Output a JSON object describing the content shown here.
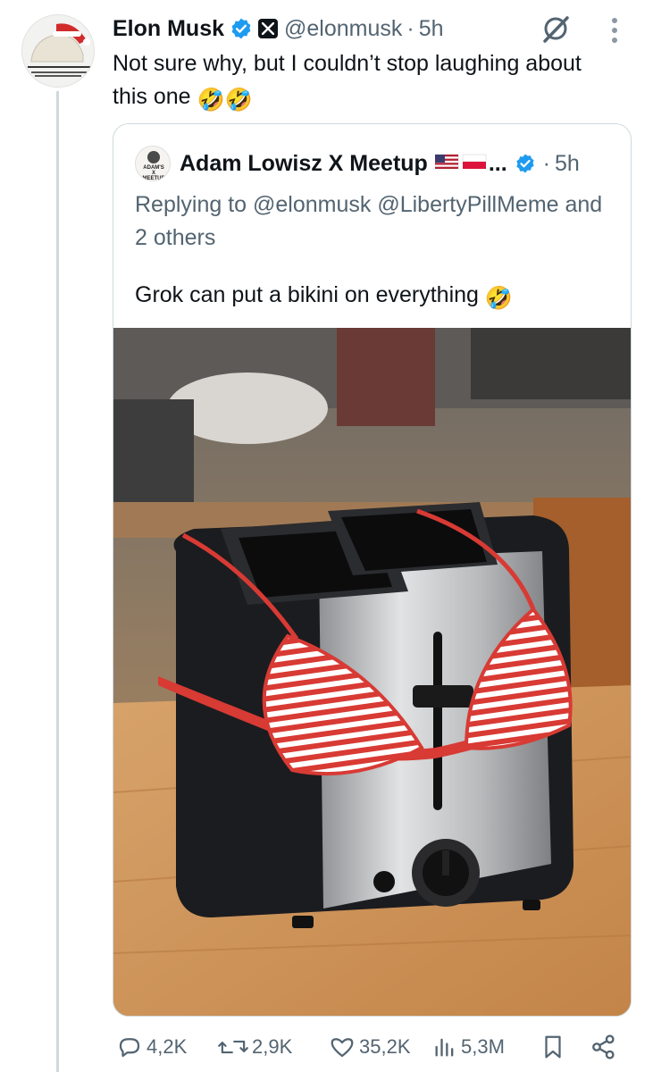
{
  "tweet": {
    "author_name": "Elon Musk",
    "handle": "@elonmusk",
    "separator": "·",
    "time": "5h",
    "text": "Not sure why, but I couldn’t stop laughing about this one",
    "text_emoji": "🤣🤣"
  },
  "quote": {
    "author_name": "Adam Lowisz X Meetup",
    "flags": "🇺🇸🇵🇱",
    "ellipsis": "...",
    "separator": "·",
    "time": "5h",
    "reply_line": "Replying to @elonmusk @LibertyPillMeme and 2 others",
    "text": "Grok can put a bikini on everything",
    "text_emoji": "🤣",
    "avatar_text_1": "ADAM'S",
    "avatar_text_2": "X",
    "avatar_text_3": "MEETUP"
  },
  "actions": {
    "replies": "4,2K",
    "reposts": "2,9K",
    "likes": "35,2K",
    "views": "5,3M"
  },
  "icons": [
    "verified-badge-icon",
    "x-logo-icon",
    "grok-icon",
    "more-icon",
    "reply-icon",
    "repost-icon",
    "like-icon",
    "views-icon",
    "bookmark-icon",
    "share-icon"
  ],
  "colors": {
    "verified": "#1d9bf0",
    "text": "#0f1419",
    "secondary": "#536471",
    "border": "#cfd9de"
  }
}
